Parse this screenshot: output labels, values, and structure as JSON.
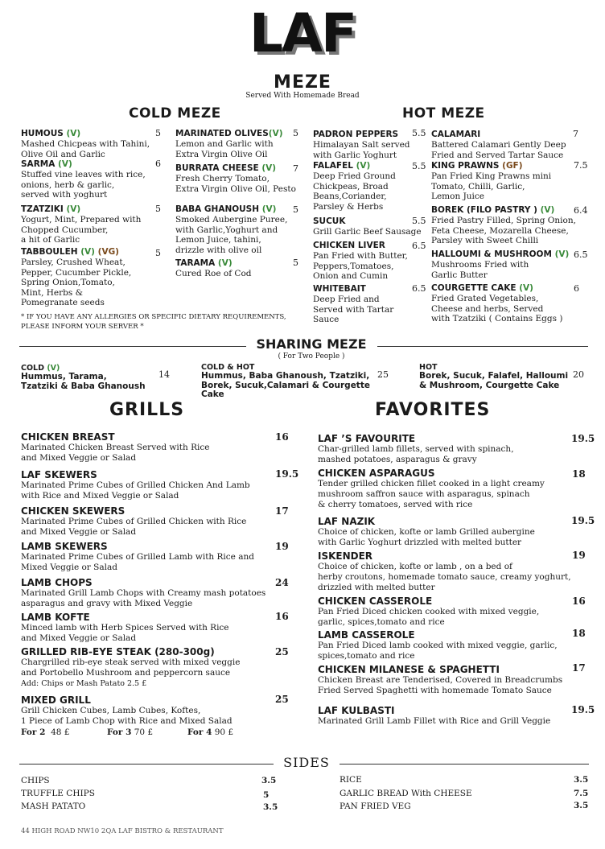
{
  "logo": "LAF",
  "meze": {
    "title": "MEZE",
    "subtitle": "Served With Homemade Bread"
  },
  "cold_meze": {
    "title": "COLD MEZE",
    "items": [
      {
        "name": "HUMOUS",
        "tag": "(V)",
        "price": "5",
        "desc": "Mashed Chicpeas with Tahini,\nOlive Oil and Garlic"
      },
      {
        "name": "SARMA",
        "tag": "(V)",
        "price": "6",
        "desc": "Stuffed vine leaves with rice,\nonions, herb & garlic,\nserved with yoghurt"
      },
      {
        "name": "TZATZIKI",
        "tag": "(V)",
        "price": "5",
        "desc": "Yogurt, Mint, Prepared with\nChopped Cucumber,\na hit of Garlic"
      },
      {
        "name": "TABBOULEH",
        "tag": "(V)",
        "tag2": "(VG)",
        "price": "5",
        "desc": "Parsley, Crushed Wheat,\nPepper, Cucumber Pickle,\nSpring Onion,Tomato,\nMint, Herbs &\nPomegranate seeds"
      },
      {
        "name": "MARINATED OLIVES",
        "tag": "(V)",
        "price": "5",
        "desc": "Lemon and Garlic with\nExtra Virgin Olive Oil"
      },
      {
        "name": "BURRATA CHEESE",
        "tag": "(V)",
        "price": "7",
        "desc": "Fresh Cherry Tomato,\nExtra Virgin Olive Oil, Pesto"
      },
      {
        "name": "BABA GHANOUSH",
        "tag": "(V)",
        "price": "5",
        "desc": "Smoked Aubergine Puree,\nwith Garlic,Yoghurt and\nLemon Juice, tahini,\ndrizzle with olive oil"
      },
      {
        "name": "TARAMA",
        "tag": "(V)",
        "price": "5",
        "desc": "Cured Roe of Cod"
      }
    ],
    "note": "* IF YOU HAVE ANY ALLERGIES OR SPECIFIC DIETARY REQUIREMENTS,\nPLEASE INFORM YOUR SERVER *"
  },
  "hot_meze": {
    "title": "HOT MEZE",
    "items": [
      {
        "name": "PADRON PEPPERS",
        "price": "5.5",
        "desc": "Himalayan Salt served\nwith Garlic Yoghurt"
      },
      {
        "name": "FALAFEL",
        "tag": "(V)",
        "price": "5.5",
        "desc": "Deep Fried Ground\nChickpeas, Broad\nBeans,Coriander,\nParsley & Herbs"
      },
      {
        "name": "SUCUK",
        "price": "5.5",
        "desc": "Grill Garlic Beef Sausage"
      },
      {
        "name": "CHICKEN LIVER",
        "price": "6.5",
        "desc": "Pan Fried with Butter,\nPeppers,Tomatoes,\nOnion and Cumin"
      },
      {
        "name": "WHITEBAIT",
        "price": "6.5",
        "desc": "Deep Fried and\nServed with Tartar\nSauce"
      },
      {
        "name": "CALAMARI",
        "price": "7",
        "desc": "Battered Calamari Gently Deep\nFried and Served Tartar Sauce"
      },
      {
        "name": "KING PRAWNS",
        "tag": "(GF)",
        "price": "7.5",
        "desc": "Pan Fried King Prawns mini\nTomato, Chilli, Garlic,\nLemon Juice"
      },
      {
        "name": "BOREK (FILO PASTRY )",
        "tag": "(V)",
        "price": "6.4",
        "desc": "Fried Pastry Filled, Spring Onion,\nFeta Cheese, Mozarella Cheese,\nParsley with Sweet Chilli"
      },
      {
        "name": "HALLOUMI & MUSHROOM",
        "tag": "(V)",
        "price": "6.5",
        "desc": "Mushrooms Fried with\nGarlic Butter"
      },
      {
        "name": "COURGETTE CAKE",
        "tag": "(V)",
        "price": "6",
        "desc": "Fried Grated Vegetables,\nCheese and herbs, Served\nwith Tzatziki ( Contains Eggs )"
      }
    ]
  },
  "sharing": {
    "title": "SHARING MEZE",
    "subtitle": "( For Two People )",
    "options": [
      {
        "name": "COLD",
        "tag": "(V)",
        "desc": "Hummus, Tarama,\nTzatziki  & Baba Ghanoush",
        "price": "14"
      },
      {
        "name": "COLD & HOT",
        "desc": "Hummus, Baba Ghanoush, Tzatziki,\nBorek, Sucuk,Calamari  & Courgette Cake",
        "price": "25"
      },
      {
        "name": "HOT",
        "desc": "Borek, Sucuk, Falafel, Halloumi\n& Mushroom, Courgette Cake",
        "price": "20"
      }
    ]
  },
  "grills": {
    "title": "GRILLS",
    "items": [
      {
        "name": "CHICKEN BREAST",
        "price": "16",
        "desc": "Marinated Chicken Breast Served with Rice\nand Mixed Veggie or Salad"
      },
      {
        "name": "LAF SKEWERS",
        "price": "19.5",
        "desc": "Marinated Prime Cubes of Grilled Chicken And Lamb\nwith Rice and Mixed Veggie or Salad"
      },
      {
        "name": "CHICKEN SKEWERS",
        "price": "17",
        "desc": "Marinated Prime Cubes of Grilled Chicken with Rice\nand Mixed Veggie or Salad"
      },
      {
        "name": "LAMB SKEWERS",
        "price": "19",
        "desc": "Marinated Prime Cubes of Grilled Lamb with Rice and\nMixed Veggie or Salad"
      },
      {
        "name": "LAMB CHOPS",
        "price": "24",
        "desc": "Marinated Grill Lamb Chops with Creamy mash potatoes\nasparagus and gravy with Mixed Veggie"
      },
      {
        "name": "LAMB KOFTE",
        "price": "16",
        "desc": "Minced lamb with Herb Spices Served with Rice\nand Mixed Veggie or Salad"
      },
      {
        "name": "GRILLED RIB-EYE STEAK (280-300g)",
        "price": "25",
        "desc": "Chargrilled rib-eye steak served with mixed veggie\nand Portobello Mushroom and peppercorn sauce"
      },
      {
        "name": "MIXED GRILL",
        "price": "25",
        "desc": "Grill Chicken Cubes, Lamb Cubes, Koftes,\n1 Piece of Lamb Chop with Rice and Mixed Salad"
      }
    ],
    "addon": "Add: Chips or Mash Patato 2.5  £",
    "mixed_options": [
      {
        "label": "For 2",
        "price": "48 £"
      },
      {
        "label": "For 3",
        "price": "70 £"
      },
      {
        "label": "For 4",
        "price": "90 £"
      }
    ]
  },
  "favorites": {
    "title": "FAVORITES",
    "items": [
      {
        "name": "LAF ’S FAVOURITE",
        "price": "19.5",
        "desc": "Char-grilled lamb fillets, served with spinach,\nmashed potatoes, asparagus & gravy"
      },
      {
        "name": "CHICKEN ASPARAGUS",
        "price": "18",
        "desc": "Tender grilled chicken fillet cooked in a light creamy\nmushroom saffron sauce with asparagus, spinach\n& cherry tomatoes, served with rice"
      },
      {
        "name": "LAF NAZIK",
        "price": "19.5",
        "desc": "Choice of chicken, kofte or lamb Grilled aubergine\nwith Garlic Yoghurt drizzled with melted butter"
      },
      {
        "name": "ISKENDER",
        "price": "19",
        "desc": "Choice of chicken, kofte or lamb , on a bed of\nherby croutons, homemade tomato sauce, creamy yoghurt,\ndrizzled with melted butter"
      },
      {
        "name": "CHICKEN CASSEROLE",
        "price": "16",
        "desc": "Pan Fried Diced chicken cooked with mixed veggie,\ngarlic, spices,tomato and rice"
      },
      {
        "name": "LAMB CASSEROLE",
        "price": "18",
        "desc": "Pan Fried Diced lamb cooked with mixed veggie, garlic,\nspices,tomato and rice"
      },
      {
        "name": "CHICKEN MILANESE & SPAGHETTI",
        "price": "17",
        "desc": "Chicken Breast are Tenderised, Covered in Breadcrumbs\nFried Served Spaghetti with homemade Tomato Sauce"
      },
      {
        "name": "LAF KULBASTI",
        "price": "19.5",
        "desc": "Marinated Grill Lamb Fillet with Rice and Grill Veggie"
      }
    ]
  },
  "sides": {
    "title": "SIDES",
    "left": [
      {
        "name": "CHIPS",
        "price": "3.5"
      },
      {
        "name": "TRUFFLE CHIPS",
        "price": "5"
      },
      {
        "name": "MASH PATATO",
        "price": "3.5"
      }
    ],
    "right": [
      {
        "name": "RICE",
        "price": "3.5"
      },
      {
        "name": "GARLIC BREAD With CHEESE",
        "price": "7.5"
      },
      {
        "name": "PAN FRIED VEG",
        "price": "3.5"
      }
    ]
  },
  "footer": "44 HIGH ROAD NW10 2QA LAF BISTRO &  RESTAURANT"
}
